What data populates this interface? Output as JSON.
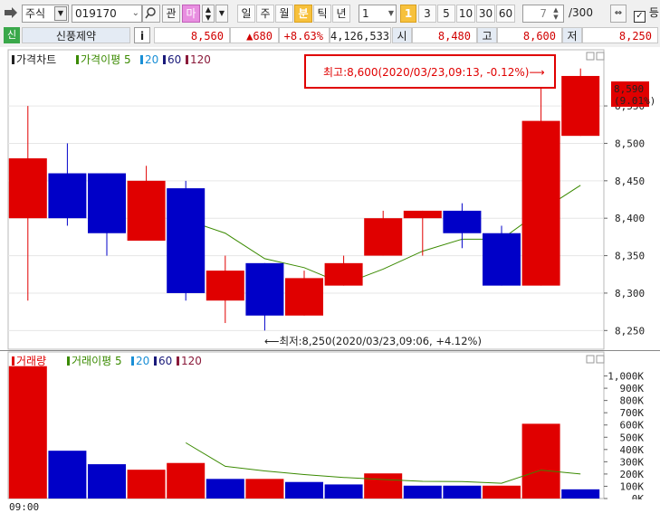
{
  "toolbar": {
    "market_type": "주식",
    "code": "019170",
    "btn_gwan": "관",
    "btn_ma": "마",
    "period_tabs": [
      "일",
      "주",
      "월",
      "분",
      "틱",
      "년"
    ],
    "period_active": "분",
    "interval_value": "1",
    "interval_buttons": [
      "1",
      "3",
      "5",
      "10",
      "30",
      "60"
    ],
    "interval_active": "1",
    "count_current": "7",
    "count_total": "/300",
    "check_label": "등"
  },
  "stock": {
    "badge": "신",
    "name": "신풍제약",
    "info_btn": "i",
    "price": "8,560",
    "change": "▲680",
    "change_pct": "+8.63%",
    "volume": "4,126,533",
    "open_label": "시",
    "open": "8,480",
    "high_label": "고",
    "high": "8,600",
    "low_label": "저",
    "low": "8,250"
  },
  "colors": {
    "up": "#e00000",
    "down": "#0000c8",
    "ma5": "#3a8a00",
    "ma20": "#1a8fd6",
    "ma60": "#1a1a7a",
    "ma120": "#8a1a3a",
    "annotation_border": "#e00000"
  },
  "price_panel": {
    "legend_title": "가격차트",
    "legend_ma": "가격이평 5",
    "legend_20": "20",
    "legend_60": "60",
    "legend_120": "120",
    "high_annotation": "최고:8,600(2020/03/23,09:13, -0.12%)⟶",
    "low_annotation": "⟵최저:8,250(2020/03/23,09:06, +4.12%)",
    "current_price_tag": "8,590",
    "current_pct_tag": "(9.01%)"
  },
  "volume_panel": {
    "legend_title": "거래량",
    "legend_ma": "거래이평 5",
    "legend_20": "20",
    "legend_60": "60",
    "legend_120": "120",
    "time_label": "09:00"
  },
  "chart_data": [
    {
      "type": "candlestick",
      "ylim": [
        8225,
        8625
      ],
      "yticks": [
        "8,250",
        "8,300",
        "8,350",
        "8,400",
        "8,450",
        "8,500",
        "8,550"
      ],
      "ytick_values": [
        8250,
        8300,
        8350,
        8400,
        8450,
        8500,
        8550
      ],
      "candles": [
        {
          "o": 8400,
          "h": 8550,
          "l": 8290,
          "c": 8480
        },
        {
          "o": 8460,
          "h": 8500,
          "l": 8390,
          "c": 8400
        },
        {
          "o": 8460,
          "h": 8460,
          "l": 8350,
          "c": 8380
        },
        {
          "o": 8370,
          "h": 8470,
          "l": 8370,
          "c": 8450
        },
        {
          "o": 8440,
          "h": 8450,
          "l": 8290,
          "c": 8300
        },
        {
          "o": 8290,
          "h": 8350,
          "l": 8260,
          "c": 8330
        },
        {
          "o": 8340,
          "h": 8340,
          "l": 8250,
          "c": 8270
        },
        {
          "o": 8270,
          "h": 8330,
          "l": 8270,
          "c": 8320
        },
        {
          "o": 8310,
          "h": 8350,
          "l": 8310,
          "c": 8340
        },
        {
          "o": 8350,
          "h": 8410,
          "l": 8350,
          "c": 8400
        },
        {
          "o": 8400,
          "h": 8410,
          "l": 8350,
          "c": 8410
        },
        {
          "o": 8410,
          "h": 8420,
          "l": 8360,
          "c": 8380
        },
        {
          "o": 8380,
          "h": 8390,
          "l": 8310,
          "c": 8310
        },
        {
          "o": 8310,
          "h": 8600,
          "l": 8310,
          "c": 8530
        },
        {
          "o": 8510,
          "h": 8600,
          "l": 8510,
          "c": 8590
        }
      ],
      "ma5": [
        null,
        null,
        null,
        null,
        8398,
        8380,
        8346,
        8334,
        8312,
        8332,
        8356,
        8372,
        8372,
        8410,
        8444
      ]
    },
    {
      "type": "bar",
      "ylim": [
        0,
        1100000
      ],
      "yticks": [
        "0K",
        "100K",
        "200K",
        "300K",
        "400K",
        "500K",
        "600K",
        "700K",
        "800K",
        "900K",
        "1,000K"
      ],
      "ytick_values": [
        0,
        100000,
        200000,
        300000,
        400000,
        500000,
        600000,
        700000,
        800000,
        900000,
        1000000
      ],
      "values": [
        1080000,
        390000,
        280000,
        235000,
        290000,
        160000,
        160000,
        135000,
        115000,
        205000,
        105000,
        105000,
        105000,
        610000,
        75000
      ],
      "up": [
        true,
        false,
        false,
        true,
        true,
        false,
        true,
        false,
        false,
        true,
        false,
        false,
        true,
        true,
        false
      ],
      "ma5": [
        null,
        null,
        null,
        null,
        455000,
        263000,
        225000,
        196000,
        172000,
        155000,
        140000,
        138000,
        125000,
        232000,
        200000
      ]
    }
  ]
}
